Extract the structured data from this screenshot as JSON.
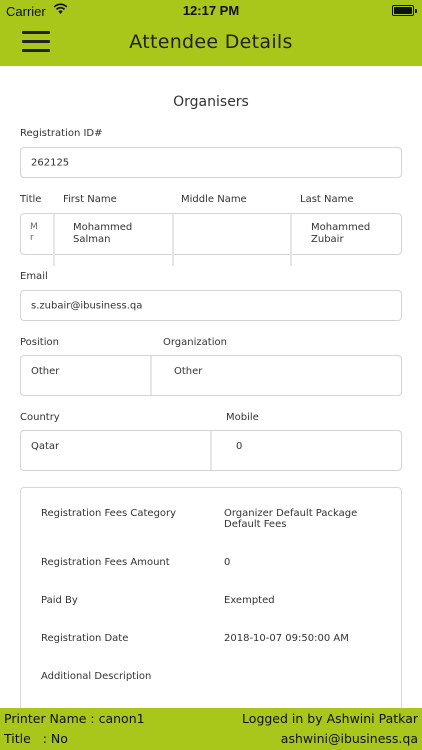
{
  "status_bar": {
    "carrier": "Carrier",
    "time": "12:17 PM"
  },
  "nav": {
    "title": "Attendee Details",
    "menu_icon": "hamburger-icon"
  },
  "section": {
    "title": "Organisers"
  },
  "registration": {
    "label": "Registration ID#",
    "value": "262125"
  },
  "name": {
    "title_label": "Title",
    "first_label": "First Name",
    "middle_label": "Middle Name",
    "last_label": "Last Name",
    "title_value": "M r .",
    "first_value": "Mohammed Salman",
    "middle_value": "",
    "last_value": "Mohammed Zubair"
  },
  "email": {
    "label": "Email",
    "value": "s.zubair@ibusiness.qa"
  },
  "position": {
    "label": "Position",
    "value": "Other"
  },
  "organization": {
    "label": "Organization",
    "value": "Other"
  },
  "country": {
    "label": "Country",
    "value": "Qatar"
  },
  "mobile": {
    "label": "Mobile",
    "value": "0"
  },
  "fees": {
    "category_label": "Registration Fees Category",
    "category_value": "Organizer Default Package Default Fees",
    "amount_label": "Registration Fees Amount",
    "amount_value": "0",
    "paid_label": "Paid By",
    "paid_value": "Exempted",
    "date_label": "Registration Date",
    "date_value": "2018-10-07 09:50:00 AM",
    "desc_label": "Additional Description"
  },
  "footer": {
    "printer": "Printer Name : canon1",
    "logged": "Logged in by Ashwini Patkar",
    "title": "Title   : No",
    "email": "ashwini@ibusiness.qa"
  }
}
